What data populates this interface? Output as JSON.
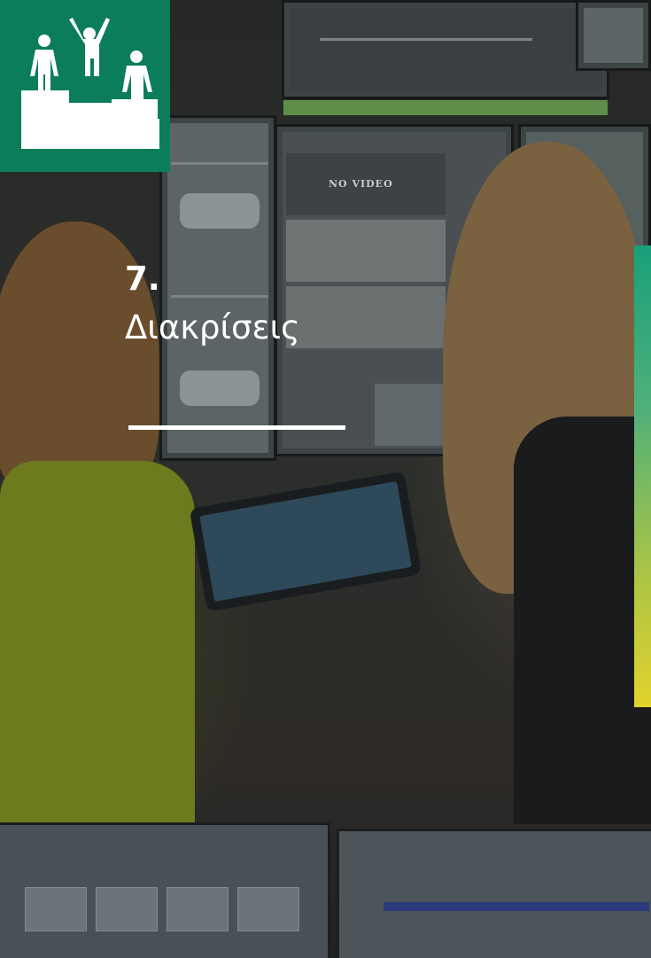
{
  "section": {
    "number": "7.",
    "title": "Διακρίσεις"
  },
  "badge": {
    "icon": "podium-icon",
    "background": "#0b7d5b"
  },
  "accent_bar": {
    "gradient_top": "#18a07a",
    "gradient_bottom": "#e2d22c"
  },
  "photo": {
    "monitor_caption": "NO VIDEO"
  }
}
